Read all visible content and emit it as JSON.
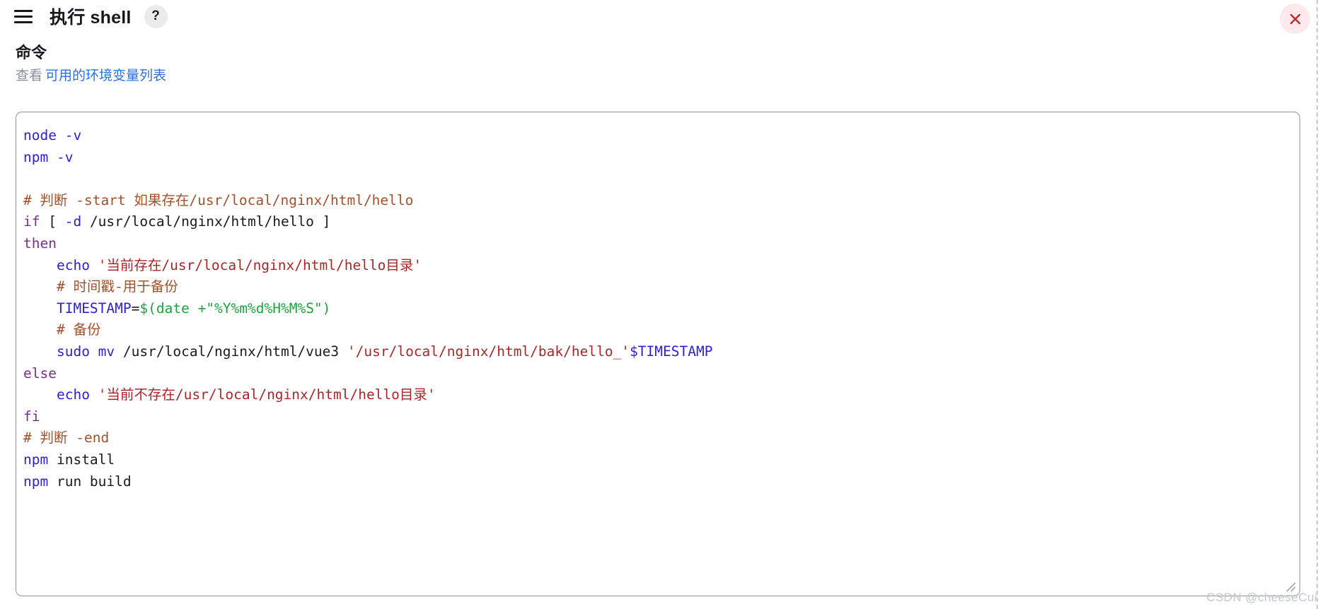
{
  "header": {
    "menu_icon": "hamburger-menu-icon",
    "title": "执行 shell",
    "help_label": "?",
    "close_icon": "close-x-icon",
    "close_color": "#c12b2b",
    "close_bg": "#fbe9ec"
  },
  "command_section": {
    "title": "命令",
    "hint_prefix": "查看",
    "hint_link": "可用的环境变量列表",
    "link_color": "#2e6ee6"
  },
  "editor": {
    "border_color": "#8c97a6",
    "background": "#ffffff",
    "resize_handle_icon": "resize-grip-icon",
    "lines": [
      [
        {
          "t": "node",
          "c": "cmd"
        },
        {
          "t": " ",
          "c": "plain"
        },
        {
          "t": "-v",
          "c": "opt"
        }
      ],
      [
        {
          "t": "npm",
          "c": "cmd"
        },
        {
          "t": " ",
          "c": "plain"
        },
        {
          "t": "-v",
          "c": "opt"
        }
      ],
      [],
      [
        {
          "t": "# 判断 -start 如果存在/usr/local/nginx/html/hello",
          "c": "cmt"
        }
      ],
      [
        {
          "t": "if",
          "c": "kw"
        },
        {
          "t": " [ ",
          "c": "plain"
        },
        {
          "t": "-d",
          "c": "opt"
        },
        {
          "t": " /usr/local/nginx/html/hello ]",
          "c": "plain"
        }
      ],
      [
        {
          "t": "then",
          "c": "kw"
        }
      ],
      [
        {
          "t": "    ",
          "c": "plain"
        },
        {
          "t": "echo",
          "c": "cmd"
        },
        {
          "t": " ",
          "c": "plain"
        },
        {
          "t": "'当前存在/usr/local/nginx/html/hello目录'",
          "c": "str"
        }
      ],
      [
        {
          "t": "    ",
          "c": "plain"
        },
        {
          "t": "# 时间戳-用于备份",
          "c": "cmt"
        }
      ],
      [
        {
          "t": "    ",
          "c": "plain"
        },
        {
          "t": "TIMESTAMP",
          "c": "var"
        },
        {
          "t": "=",
          "c": "plain"
        },
        {
          "t": "$(date +\"%Y%m%d%H%M%S\")",
          "c": "subst"
        }
      ],
      [
        {
          "t": "    ",
          "c": "plain"
        },
        {
          "t": "# 备份",
          "c": "cmt"
        }
      ],
      [
        {
          "t": "    ",
          "c": "plain"
        },
        {
          "t": "sudo mv",
          "c": "cmd"
        },
        {
          "t": " /usr/local/nginx/html/vue3 ",
          "c": "plain"
        },
        {
          "t": "'/usr/local/nginx/html/bak/hello_'",
          "c": "str"
        },
        {
          "t": "$TIMESTAMP",
          "c": "var"
        }
      ],
      [
        {
          "t": "else",
          "c": "kw"
        }
      ],
      [
        {
          "t": "    ",
          "c": "plain"
        },
        {
          "t": "echo",
          "c": "cmd"
        },
        {
          "t": " ",
          "c": "plain"
        },
        {
          "t": "'当前不存在/usr/local/nginx/html/hello目录'",
          "c": "str"
        }
      ],
      [
        {
          "t": "fi",
          "c": "kw"
        }
      ],
      [
        {
          "t": "# 判断 -end",
          "c": "cmt"
        }
      ],
      [
        {
          "t": "npm",
          "c": "cmd"
        },
        {
          "t": " install",
          "c": "plain"
        }
      ],
      [
        {
          "t": "npm",
          "c": "cmd"
        },
        {
          "t": " run build",
          "c": "plain"
        }
      ]
    ]
  },
  "watermark": {
    "text": "CSDN @cheeseCui"
  }
}
